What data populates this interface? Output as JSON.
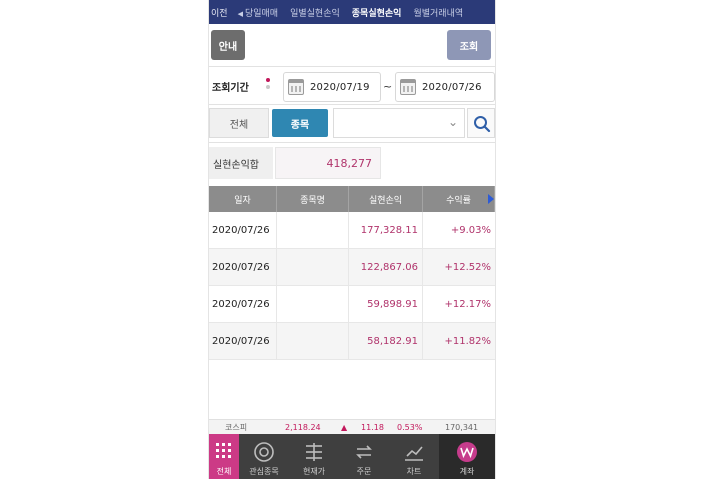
{
  "tabs": {
    "prev": "이전",
    "items": [
      "당일매매",
      "일별실현손익",
      "종목실현손익",
      "월별거래내역"
    ],
    "active_index": 2
  },
  "header": {
    "guide_label": "안내",
    "query_label": "조회"
  },
  "period": {
    "label": "조회기간",
    "start_date": "2020/07/19",
    "separator": "~",
    "end_date": "2020/07/26"
  },
  "filter": {
    "all_label": "전체",
    "item_label": "종목",
    "selected_item": ""
  },
  "summary": {
    "label": "실현손익합",
    "value": "418,277"
  },
  "table": {
    "headers": [
      "일자",
      "종목명",
      "실현손익",
      "수익률"
    ],
    "rows": [
      {
        "date": "2020/07/26",
        "name": "",
        "pnl": "177,328.11",
        "rate": "+9.03%"
      },
      {
        "date": "2020/07/26",
        "name": "",
        "pnl": "122,867.06",
        "rate": "+12.52%"
      },
      {
        "date": "2020/07/26",
        "name": "",
        "pnl": "59,898.91",
        "rate": "+12.17%"
      },
      {
        "date": "2020/07/26",
        "name": "",
        "pnl": "58,182.91",
        "rate": "+11.82%"
      }
    ]
  },
  "ticker": {
    "index_name": "코스피",
    "index_value": "2,118.24",
    "change": "11.18",
    "change_pct": "0.53%",
    "volume": "170,341"
  },
  "bottom_nav": {
    "menu": "전체",
    "items": [
      "관심종목",
      "현재가",
      "주문",
      "차트",
      "계좌"
    ]
  },
  "colors": {
    "tab_bar": "#2b3a78",
    "accent_blue": "#2f87b2",
    "profit": "#b0336b",
    "menu_pink": "#cc3a86"
  }
}
